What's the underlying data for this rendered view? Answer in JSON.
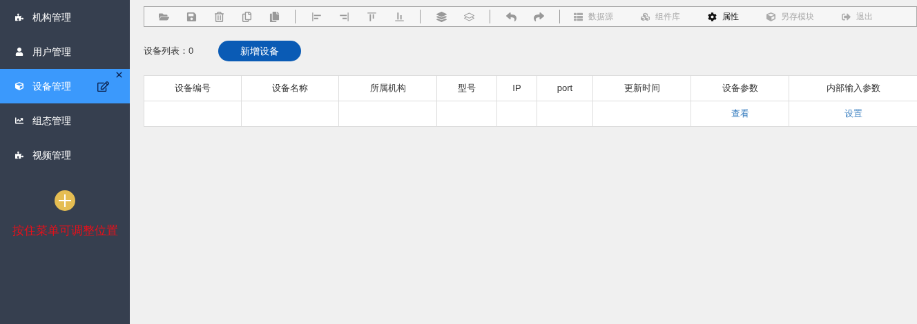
{
  "sidebar": {
    "items": [
      {
        "label": "机构管理",
        "selected": false
      },
      {
        "label": "用户管理",
        "selected": false
      },
      {
        "label": "设备管理",
        "selected": true
      },
      {
        "label": "组态管理",
        "selected": false
      },
      {
        "label": "视频管理",
        "selected": false
      }
    ],
    "hint": "按住菜单可调整位置"
  },
  "toolbar": {
    "tools": [
      {
        "label": "数据源",
        "selected": false
      },
      {
        "label": "组件库",
        "selected": false
      },
      {
        "label": "属性",
        "selected": true
      },
      {
        "label": "另存模块",
        "selected": false
      },
      {
        "label": "退出",
        "selected": false
      }
    ]
  },
  "device_count": "设备列表：0",
  "add_button": "新增设备",
  "table": {
    "columns": [
      "设备编号",
      "设备名称",
      "所属机构",
      "型号",
      "IP",
      "port",
      "更新时间",
      "设备参数",
      "内部输入参数"
    ],
    "rows": [
      {
        "device_params_link": "查看",
        "input_params_link": "设置"
      }
    ]
  }
}
